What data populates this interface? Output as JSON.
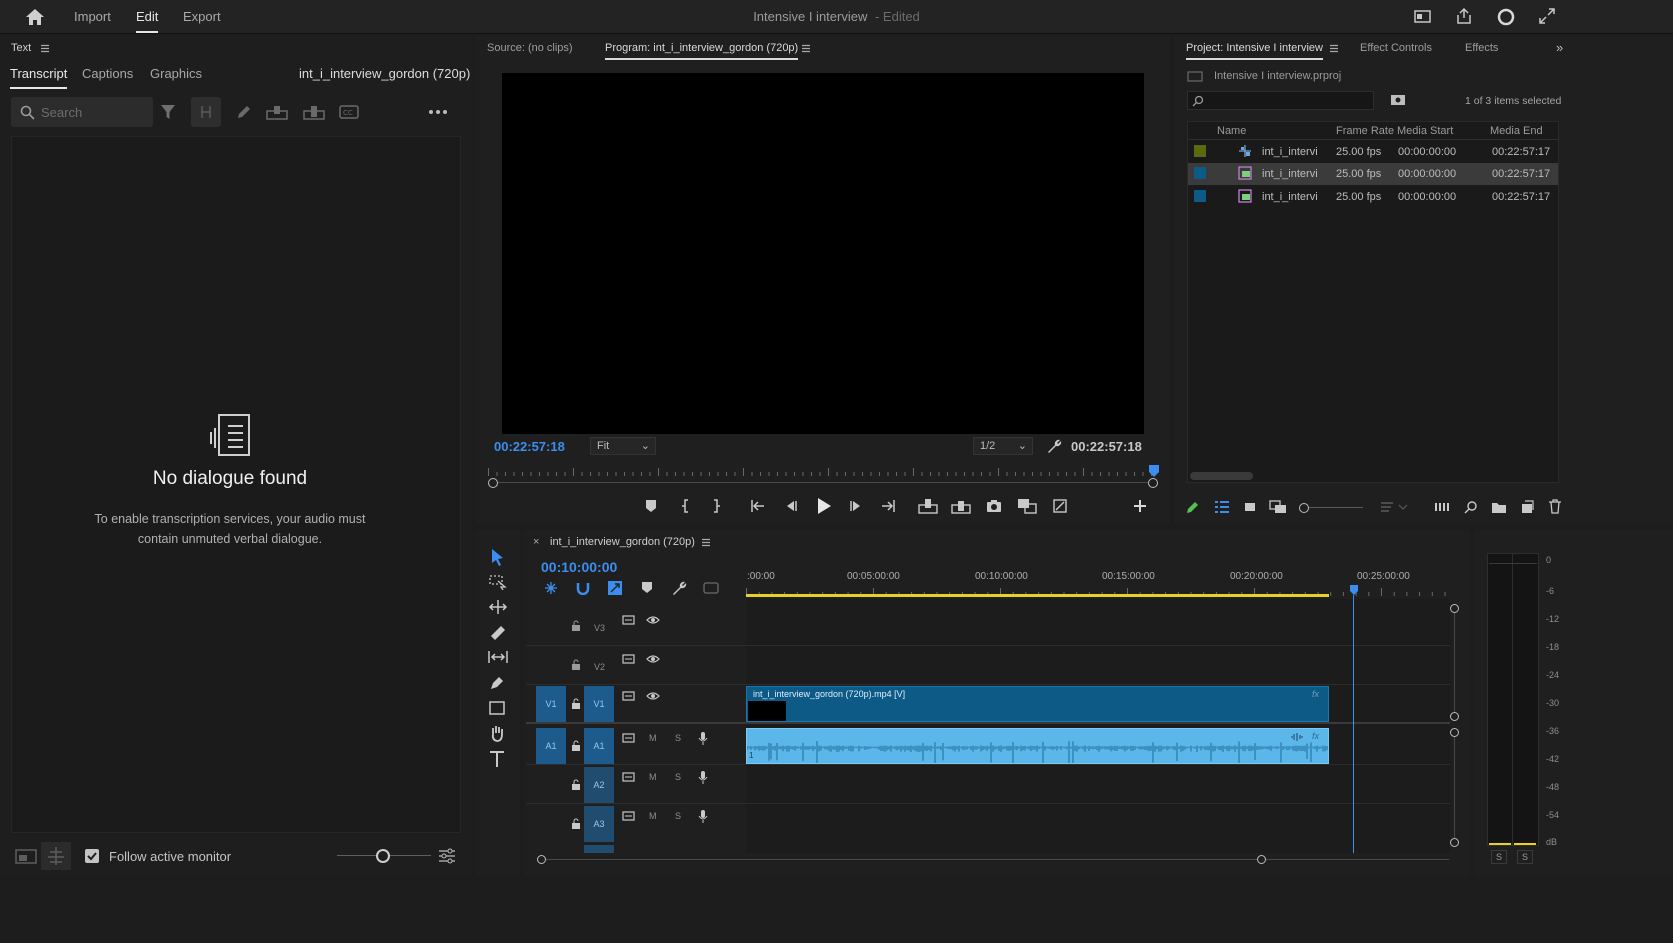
{
  "topbar": {
    "nav": [
      "Import",
      "Edit",
      "Export"
    ],
    "active_nav": "Edit",
    "title": "Intensive I interview",
    "edited": "- Edited"
  },
  "text_panel": {
    "title": "Text",
    "tabs": [
      "Transcript",
      "Captions",
      "Graphics"
    ],
    "active_tab": "Transcript",
    "sequence_name": "int_i_interview_gordon (720p)",
    "search_placeholder": "Search",
    "empty_title": "No dialogue found",
    "empty_desc": "To enable transcription services, your audio must contain unmuted verbal dialogue.",
    "follow_label": "Follow active monitor",
    "follow_checked": true
  },
  "monitor": {
    "source_tab": "Source: (no clips)",
    "program_tab": "Program: int_i_interview_gordon (720p)",
    "timecode_left": "00:22:57:18",
    "timecode_right": "00:22:57:18",
    "fit_label": "Fit",
    "resolution_label": "1/2"
  },
  "project": {
    "tabs": [
      "Project: Intensive I interview",
      "Effect Controls",
      "Effects"
    ],
    "file_name": "Intensive I interview.prproj",
    "selection_count": "1 of 3 items selected",
    "columns": [
      "Name",
      "Frame Rate",
      "Media Start",
      "Media End"
    ],
    "rows": [
      {
        "name": "int_i_intervi",
        "fps": "25.00 fps",
        "start": "00:00:00:00",
        "end": "00:22:57:17",
        "color": "#5a6a10",
        "icon": "sequence-icon"
      },
      {
        "name": "int_i_intervi",
        "fps": "25.00 fps",
        "start": "00:00:00:00",
        "end": "00:22:57:17",
        "color": "#0e5a86",
        "icon": "video-clip-icon"
      },
      {
        "name": "int_i_intervi",
        "fps": "25.00 fps",
        "start": "00:00:00:00",
        "end": "00:22:57:17",
        "color": "#0e5a86",
        "icon": "video-clip-icon"
      }
    ]
  },
  "timeline": {
    "sequence_tab": "int_i_interview_gordon (720p)",
    "playhead_timecode": "00:10:00:00",
    "ruler": [
      ":00:00",
      "00:05:00:00",
      "00:10:00:00",
      "00:15:00:00",
      "00:20:00:00",
      "00:25:00:00"
    ],
    "tracks": {
      "v3": "V3",
      "v2": "V2",
      "v1": "V1",
      "a1": "A1",
      "a2": "A2",
      "a3": "A3",
      "m": "M",
      "s": "S"
    },
    "video_clip": "int_i_interview_gordon (720p).mp4 [V]",
    "fx": "fx",
    "audio_channel": "1"
  },
  "meter": {
    "scale": [
      "0",
      "-6",
      "-12",
      "-18",
      "-24",
      "-30",
      "-36",
      "-42",
      "-48",
      "-54",
      "dB"
    ],
    "solo_left": "S",
    "solo_right": "S"
  },
  "colors": {
    "accent": "#3b8ef0",
    "clip_video": "#0e5a86",
    "clip_audio": "#5bb6ea",
    "in_out_bar": "#e8d12a"
  }
}
